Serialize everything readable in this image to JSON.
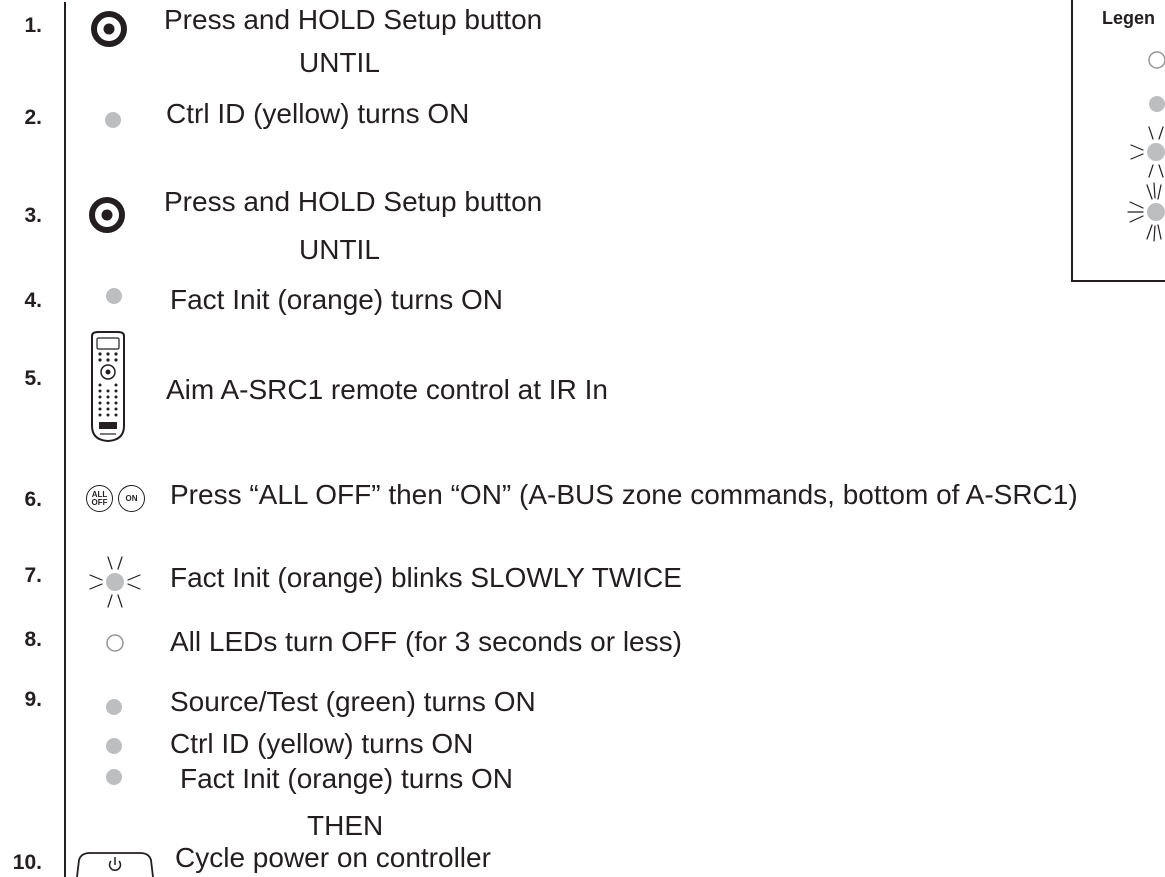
{
  "steps": [
    {
      "number": "1.",
      "icon": "setup-button-icon",
      "lines": [
        "Press and HOLD Setup button"
      ],
      "connector": "UNTIL"
    },
    {
      "number": "2.",
      "icon": "led-on-icon",
      "lines": [
        "Ctrl ID (yellow) turns ON"
      ]
    },
    {
      "number": "3.",
      "icon": "setup-button-icon",
      "lines": [
        "Press and HOLD Setup button"
      ],
      "connector": "UNTIL"
    },
    {
      "number": "4.",
      "icon": "led-on-icon",
      "lines": [
        "Fact Init (orange) turns ON"
      ]
    },
    {
      "number": "5.",
      "icon": "remote-control-icon",
      "lines": [
        "Aim A-SRC1 remote control at IR In"
      ]
    },
    {
      "number": "6.",
      "icon": "all-off-on-buttons-icon",
      "icon_labels": {
        "all_top": "ALL",
        "all_bottom": "OFF",
        "on": "ON"
      },
      "lines": [
        "Press “ALL OFF” then “ON” (A-BUS zone commands, bottom of A-SRC1)"
      ]
    },
    {
      "number": "7.",
      "icon": "led-slow-blink-icon",
      "lines": [
        "Fact Init (orange) blinks SLOWLY TWICE"
      ]
    },
    {
      "number": "8.",
      "icon": "led-off-icon",
      "lines": [
        "All LEDs turn OFF (for 3 seconds or less)"
      ]
    },
    {
      "number": "9.",
      "icon": "led-on-icon",
      "lines": [
        "Source/Test (green) turns ON",
        "Ctrl ID (yellow) turns ON",
        "Fact Init (orange) turns ON"
      ],
      "connector": "THEN"
    },
    {
      "number": "10.",
      "icon": "power-button-icon",
      "lines": [
        "Cycle power on controller"
      ]
    }
  ],
  "legend": {
    "title": "Legen",
    "items": [
      {
        "icon": "led-off-icon"
      },
      {
        "icon": "led-on-icon"
      },
      {
        "icon": "led-slow-blink-icon"
      },
      {
        "icon": "led-fast-blink-icon"
      }
    ]
  },
  "colors": {
    "ink": "#231f20",
    "led": "#bcbec0",
    "led_off_stroke": "#939598"
  }
}
